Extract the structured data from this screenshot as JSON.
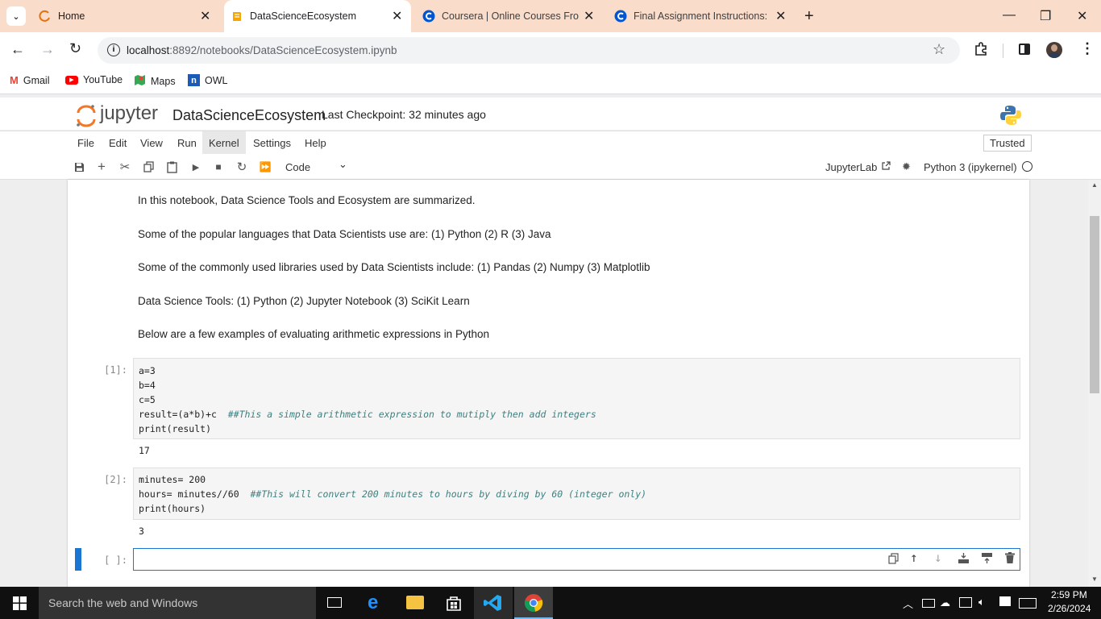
{
  "browser": {
    "tabs": [
      {
        "title": "Home"
      },
      {
        "title": "DataScienceEcosystem"
      },
      {
        "title": "Coursera | Online Courses From"
      },
      {
        "title": "Final Assignment Instructions: C"
      }
    ],
    "url_host": "localhost",
    "url_path": ":8892/notebooks/DataScienceEcosystem.ipynb",
    "bookmarks": [
      {
        "label": "Gmail"
      },
      {
        "label": "YouTube"
      },
      {
        "label": "Maps"
      },
      {
        "label": "OWL"
      }
    ]
  },
  "jupyter": {
    "logo_text": "jupyter",
    "notebook_name": "DataScienceEcosystem",
    "checkpoint": "Last Checkpoint: 32 minutes ago",
    "trusted": "Trusted",
    "menu": [
      "File",
      "Edit",
      "View",
      "Run",
      "Kernel",
      "Settings",
      "Help"
    ],
    "cell_type": "Code",
    "jupyterlab_link": "JupyterLab",
    "kernel_name": "Python 3 (ipykernel)"
  },
  "notebook": {
    "markdown": [
      "In this notebook, Data Science Tools and Ecosystem are summarized.",
      "Some of the popular languages that Data Scientists use are: (1) Python (2) R (3) Java",
      "Some of the commonly used libraries used by Data Scientists include: (1) Pandas (2) Numpy (3) Matplotlib",
      "Data Science Tools: (1) Python (2) Jupyter Notebook (3) SciKit Learn",
      "Below are a few examples of evaluating arithmetic expressions in Python"
    ],
    "cell1": {
      "prompt": "[1]:",
      "lines": [
        "a=3",
        "b=4",
        "c=5"
      ],
      "line4_code": "result=(a*b)+c  ",
      "line4_comment": "##This a simple arithmetic expression to mutiply then add integers",
      "line5": "print(result)",
      "output": "17"
    },
    "cell2": {
      "prompt": "[2]:",
      "line1": "minutes= 200",
      "line2_code": "hours= minutes//60  ",
      "line2_comment": "##This will convert 200 minutes to hours by diving by 60 (integer only)",
      "line3": "print(hours)",
      "output": "3"
    },
    "cell3": {
      "prompt": "[ ]:"
    }
  },
  "taskbar": {
    "search_placeholder": "Search the web and Windows",
    "time": "2:59 PM",
    "date": "2/26/2024"
  },
  "colors": {
    "tabstrip": "#f9dcc9",
    "active_cell": "#1976d2",
    "comment": "#408080"
  }
}
